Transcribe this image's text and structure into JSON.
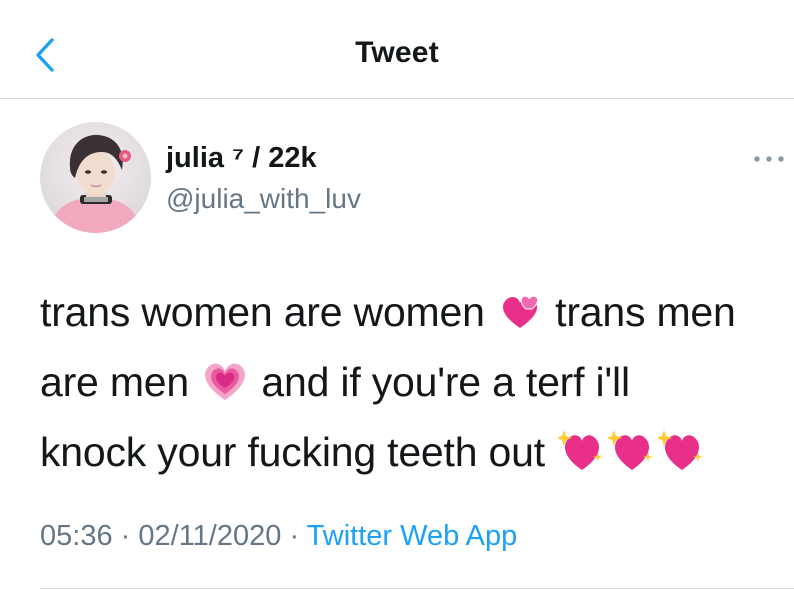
{
  "nav": {
    "title": "Tweet",
    "back_icon": "chevron-left-icon",
    "accent_color": "#1da1f2"
  },
  "author": {
    "display_name": "julia ⁷ / 22k",
    "handle": "@julia_with_luv",
    "avatar_icon": "profile-photo"
  },
  "tweet": {
    "line1_a": "trans women are women",
    "line1_b": "trans men",
    "line2_a": "are men",
    "line2_b": "and if you're a terf i'll",
    "line3_a": "knock your fucking teeth out",
    "emojis": [
      "two-hearts-icon",
      "growing-heart-icon",
      "sparkling-heart-icon",
      "sparkling-heart-icon",
      "sparkling-heart-icon"
    ]
  },
  "meta": {
    "time": "05:36",
    "sep1": "·",
    "date": "02/11/2020",
    "sep2": "·",
    "source": "Twitter Web App"
  },
  "colors": {
    "text": "#14171a",
    "secondary": "#657786",
    "divider": "#d9d9dc",
    "heart": "#e8308a"
  }
}
